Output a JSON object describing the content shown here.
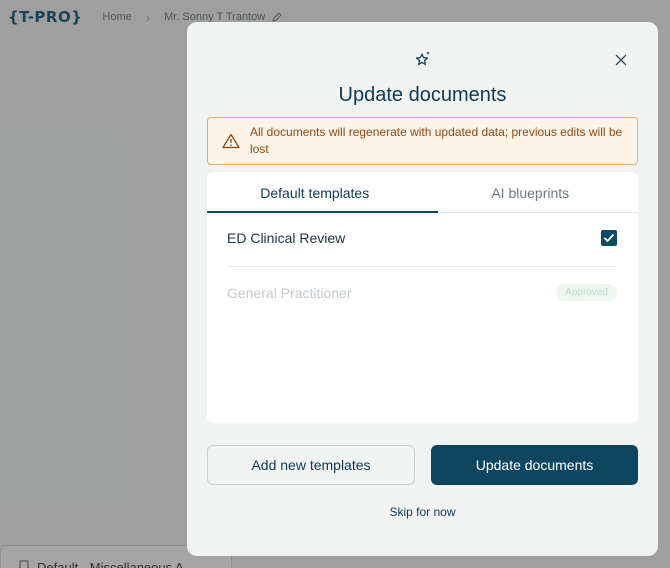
{
  "topbar": {
    "logo": "{T-PRO}",
    "breadcrumb": [
      "Home",
      "Mr. Sonny T Trantow"
    ]
  },
  "background_panel": {
    "text": "Default - Miscellaneous A"
  },
  "modal": {
    "title": "Update documents",
    "warning": "All documents will regenerate with updated data; previous edits will be lost",
    "tabs": [
      {
        "label": "Default templates",
        "active": true
      },
      {
        "label": "AI blueprints",
        "active": false
      }
    ],
    "templates": [
      {
        "name": "ED Clinical Review",
        "checked": true,
        "disabled": false
      },
      {
        "name": "General Practitioner",
        "badge": "Approved",
        "disabled": true
      }
    ],
    "buttons": {
      "add": "Add new templates",
      "update": "Update documents",
      "skip": "Skip for now"
    }
  },
  "colors": {
    "primary": "#0e4660",
    "warning_bg": "#fdf3e6",
    "warning_border": "#e6a865",
    "warning_text": "#8a4a14"
  }
}
